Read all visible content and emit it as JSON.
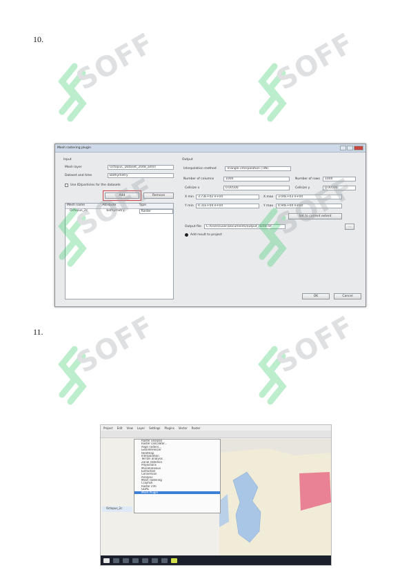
{
  "steps": [
    {
      "number": "10."
    },
    {
      "number": "11."
    }
  ],
  "watermark": {
    "text": "SOFF",
    "icon": "soff-s-logo-icon",
    "color": "#33cc66"
  },
  "dialog": {
    "title": "Mesh rastering plugin",
    "input_group": "Input",
    "output_group": "Output",
    "mesh_layer_label": "Mesh layer",
    "mesh_layer_value": "Octopus, Dataset_2048_ad(0)",
    "dataset_label": "Dataset and time",
    "dataset_value": "Bathymetry",
    "use_checkbox_label": "Use ID/particles for the datasets",
    "add_button": "Add",
    "remove_button": "Remove",
    "table_headers": [
      "Mesh name",
      "Attribute",
      "Type"
    ],
    "table_row": [
      "Octopus_2c",
      "bathymetry",
      "Raster"
    ],
    "interpolation_label": "Interpolation method",
    "interpolation_value": "Triangle interpolation (TIN)",
    "columns_label": "Number of columns",
    "columns_value": "1000",
    "rows_label": "Number of rows",
    "rows_value": "1000",
    "cellsize_label": "Cellsize x",
    "cellsize_value": "0.00500",
    "cellsize_y_label": "Cellsize y",
    "cellsize_y_value": "0.00500",
    "xmin_label": "X min",
    "xmin_value": "3.73E+02 e+04",
    "xmax_label": "X max",
    "xmax_value": "3.04E+03 e+04",
    "ymin_label": "Y min",
    "ymin_value": "4.31E+04 e+04",
    "ymax_label": "Y max",
    "ymax_value": "4.94E+04 e+04",
    "set_extent_button": "Set to current extent",
    "output_file_label": "Output file",
    "output_file_value": "C:/Users/user/Documents/output_raster.tif",
    "add_result_label": "Add result to project",
    "ok_button": "OK",
    "cancel_button": "Cancel"
  },
  "qgis": {
    "menubar": [
      "Project",
      "Edit",
      "View",
      "Layer",
      "Settings",
      "Plugins",
      "Vector",
      "Raster"
    ],
    "menu_items": [
      "Raster analysis",
      "Raster calculator...",
      "Align rasters...",
      "Georeferencer",
      "Heatmap",
      "Interpolation",
      "Terrain analysis",
      "Zonal statistics",
      "Projections",
      "Miscellaneous",
      "Extraction",
      "Conversion",
      "Analysis",
      "Mesh rastering",
      "Crayfish",
      "Raster info",
      "GDAL",
      "Mesh Plugin"
    ],
    "selected_item": "Mesh Plugin",
    "layer_label": "Octopus_2c"
  }
}
